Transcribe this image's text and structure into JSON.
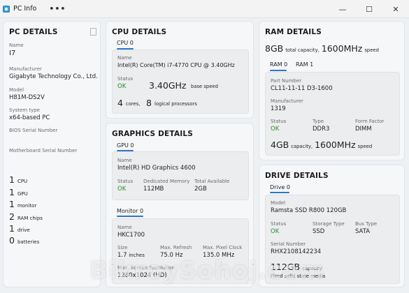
{
  "window": {
    "title": "PC Info",
    "more": "•••",
    "minimize": "—",
    "maximize": "☐",
    "close": "✕"
  },
  "pc": {
    "title": "PC DETAILS",
    "name_label": "Name",
    "name": "I7",
    "manufacturer_label": "Manufacturer",
    "manufacturer": "Gigabyte Technology Co., Ltd.",
    "model_label": "Model",
    "model": "H81M-DS2V",
    "system_type_label": "System type",
    "system_type": "x64-based PC",
    "bios_serial_label": "BIOS Serial Number",
    "mb_serial_label": "Motherboard Serial Number",
    "counts": [
      {
        "num": "1",
        "label": "CPU"
      },
      {
        "num": "1",
        "label": "GPU"
      },
      {
        "num": "1",
        "label": "monitor"
      },
      {
        "num": "2",
        "label": "RAM chips"
      },
      {
        "num": "1",
        "label": "drive"
      },
      {
        "num": "0",
        "label": "batteries"
      }
    ]
  },
  "cpu": {
    "title": "CPU DETAILS",
    "tab": "CPU 0",
    "name_label": "Name",
    "name": "Intel(R) Core(TM) i7-4770 CPU @ 3.40GHz",
    "status_label": "Status",
    "status": "OK",
    "speed": "3.40GHz",
    "speed_label": "base speed",
    "cores": "4",
    "cores_label": "cores,",
    "logical": "8",
    "logical_label": "logical processors"
  },
  "graphics": {
    "title": "GRAPHICS DETAILS",
    "gpu_tab": "GPU 0",
    "name_label": "Name",
    "name": "Intel(R) HD Graphics 4600",
    "status_label": "Status",
    "status": "OK",
    "dedicated_label": "Dedicated Memory",
    "dedicated": "112MB",
    "total_label": "Total Available",
    "total": "2GB",
    "monitor_tab": "Monitor 0",
    "mon_name_label": "Name",
    "mon_name": "HKC1700",
    "size_label": "Size",
    "size": "1.7",
    "size_unit": "inches",
    "refresh_label": "Max. Refresh",
    "refresh": "75.0 Hz",
    "pixel_label": "Max. Pixel Clock",
    "pixel": "135.0 MHz",
    "res_label": "Max. Screen Resolution",
    "res": "1280x1024 (HD)"
  },
  "ram": {
    "title": "RAM DETAILS",
    "capacity": "8GB",
    "capacity_label": "total capacity,",
    "speed": "1600MHz",
    "speed_label": "speed",
    "tab0": "RAM 0",
    "tab1": "RAM 1",
    "part_label": "Part Number",
    "part": "CL11-11-11 D3-1600",
    "manufacturer_label": "Manufacturer",
    "manufacturer": "1319",
    "status_label": "Status",
    "status": "OK",
    "type_label": "Type",
    "type": "DDR3",
    "form_label": "Form Factor",
    "form": "DIMM",
    "chip_capacity": "4GB",
    "chip_capacity_label": "capacity,",
    "chip_speed": "1600MHz",
    "chip_speed_label": "speed"
  },
  "drive": {
    "title": "DRIVE DETAILS",
    "tab": "Drive 0",
    "model_label": "Model",
    "model": "Ramsta SSD R800 120GB",
    "status_label": "Status",
    "status": "OK",
    "storage_label": "Storage Type",
    "storage": "SSD",
    "bus_label": "Bus Type",
    "bus": "SATA",
    "serial_label": "Serial Number",
    "serial": "RHX2108142234",
    "capacity": "112GB",
    "capacity_label": "capacity",
    "media": "Fixed solid state media"
  },
  "watermark": "BikroySohoj.com"
}
